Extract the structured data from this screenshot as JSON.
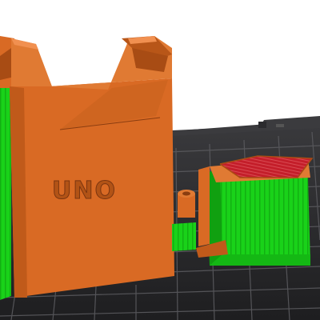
{
  "viewport": {
    "type": "slicer-3d-preview",
    "background_color": "#ffffff",
    "bed_color": "#2a2a2c",
    "grid_color": "#5a5a5e"
  },
  "colors": {
    "perimeter_orange": "#d96a24",
    "perimeter_orange_light": "#e07a33",
    "perimeter_orange_dark": "#a84c14",
    "infill_green": "#19d219",
    "infill_green_dark": "#10a010",
    "top_solid_red": "#c41e2a"
  },
  "model": {
    "embossed_text": "UNO"
  }
}
